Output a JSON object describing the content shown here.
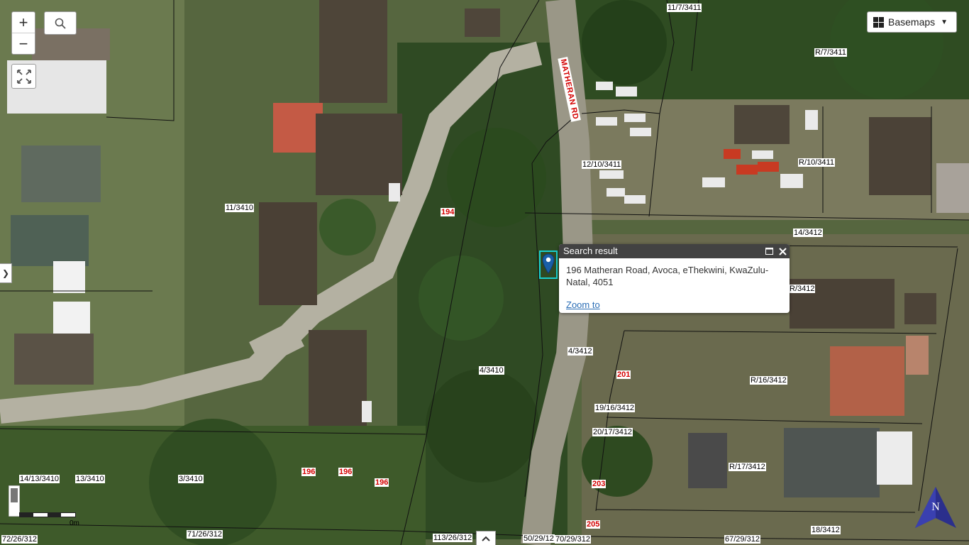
{
  "controls": {
    "zoom_in": "+",
    "zoom_out": "−",
    "basemaps_label": "Basemaps",
    "side_toggle": "❯"
  },
  "popup": {
    "title": "Search result",
    "address": "196 Matheran Road, Avoca, eThekwini, KwaZulu-Natal, 4051",
    "zoom_link": "Zoom to"
  },
  "road_label": "MATHERAN RD",
  "parcel_labels": [
    "11/7/3411",
    "R/7/3411",
    "12/10/3411",
    "R/10/3411",
    "11/3410",
    "14/3412",
    "R/3412",
    "4/3412",
    "4/3410",
    "R/16/3412",
    "19/16/3412",
    "20/17/3412",
    "R/17/3412",
    "14/13/3410",
    "13/3410",
    "3/3410",
    "18/3412",
    "71/26/312",
    "113/26/312",
    "50/29/12",
    "70/29/312",
    "67/29/312",
    "72/26/312"
  ],
  "street_numbers": [
    "194",
    "201",
    "196",
    "196",
    "196",
    "203",
    "205"
  ],
  "scale_label": "0m",
  "north_label": "N",
  "colors": {
    "popup_header": "#424242",
    "marker": "#1a5fa8",
    "highlight": "#19d0d0",
    "street_number": "#d40000"
  }
}
